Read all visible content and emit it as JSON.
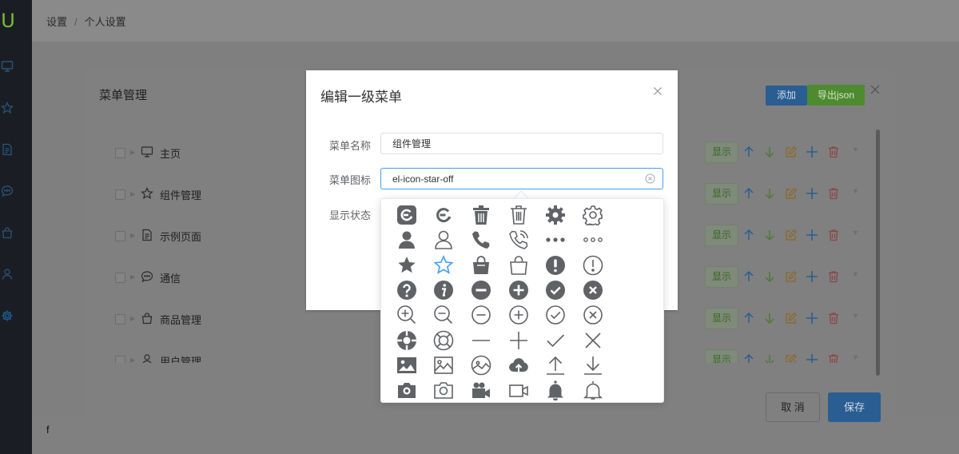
{
  "sidebar": {
    "logo": "U",
    "items": [
      {
        "icon": "monitor-icon"
      },
      {
        "icon": "star-icon"
      },
      {
        "icon": "document-icon"
      },
      {
        "icon": "chat-icon"
      },
      {
        "icon": "bag-icon"
      },
      {
        "icon": "user-icon"
      },
      {
        "icon": "gear-icon"
      }
    ]
  },
  "breadcrumb": {
    "parent": "设置",
    "separator": "/",
    "current": "个人设置"
  },
  "page": {
    "bottom_text": "f"
  },
  "menu_dialog": {
    "title": "菜单管理",
    "add_label": "添加",
    "export_label": "导出json",
    "cancel_label": "取 消",
    "save_label": "保存",
    "rows": [
      {
        "label": "主页",
        "icon": "monitor-icon",
        "show_label": "显示"
      },
      {
        "label": "组件管理",
        "icon": "star-off-icon",
        "show_label": "显示"
      },
      {
        "label": "示例页面",
        "icon": "document-icon",
        "show_label": "显示"
      },
      {
        "label": "通信",
        "icon": "chat-icon",
        "show_label": "显示"
      },
      {
        "label": "商品管理",
        "icon": "goods-icon",
        "show_label": "显示"
      },
      {
        "label": "用户管理",
        "icon": "user-icon",
        "show_label": "显示"
      }
    ]
  },
  "edit_dialog": {
    "title": "编辑一级菜单",
    "name_label": "菜单名称",
    "name_value": "组件管理",
    "icon_label": "菜单图标",
    "icon_value": "el-icon-star-off",
    "status_label": "显示状态"
  },
  "icon_picker": {
    "selected": "star-off",
    "icons": [
      "eleme",
      "eleme-outline",
      "delete-solid",
      "delete",
      "setting-solid",
      "setting",
      "user-solid",
      "user",
      "phone",
      "phone-outline",
      "more",
      "more-outline",
      "star-on",
      "star-off",
      "goods-solid",
      "goods",
      "warning",
      "warning-outline",
      "question",
      "info",
      "remove",
      "circle-plus",
      "success",
      "error",
      "zoom-in",
      "zoom-out",
      "remove-outline",
      "circle-plus-outline",
      "circle-check",
      "circle-close",
      "help-solid",
      "help",
      "minus",
      "plus",
      "check",
      "close",
      "picture",
      "picture-outline",
      "picture-outline-round",
      "upload",
      "upload2",
      "download",
      "camera-solid",
      "camera",
      "video-camera-solid",
      "video-camera",
      "bell-solid",
      "bell"
    ]
  },
  "colors": {
    "primary": "#409eff",
    "success": "#67c23a",
    "danger": "#f56c6c",
    "warning": "#e6a23c",
    "icon_gray": "#606266",
    "sidebar_bg": "#1a1e24",
    "overlay": "#7f7f7f"
  }
}
